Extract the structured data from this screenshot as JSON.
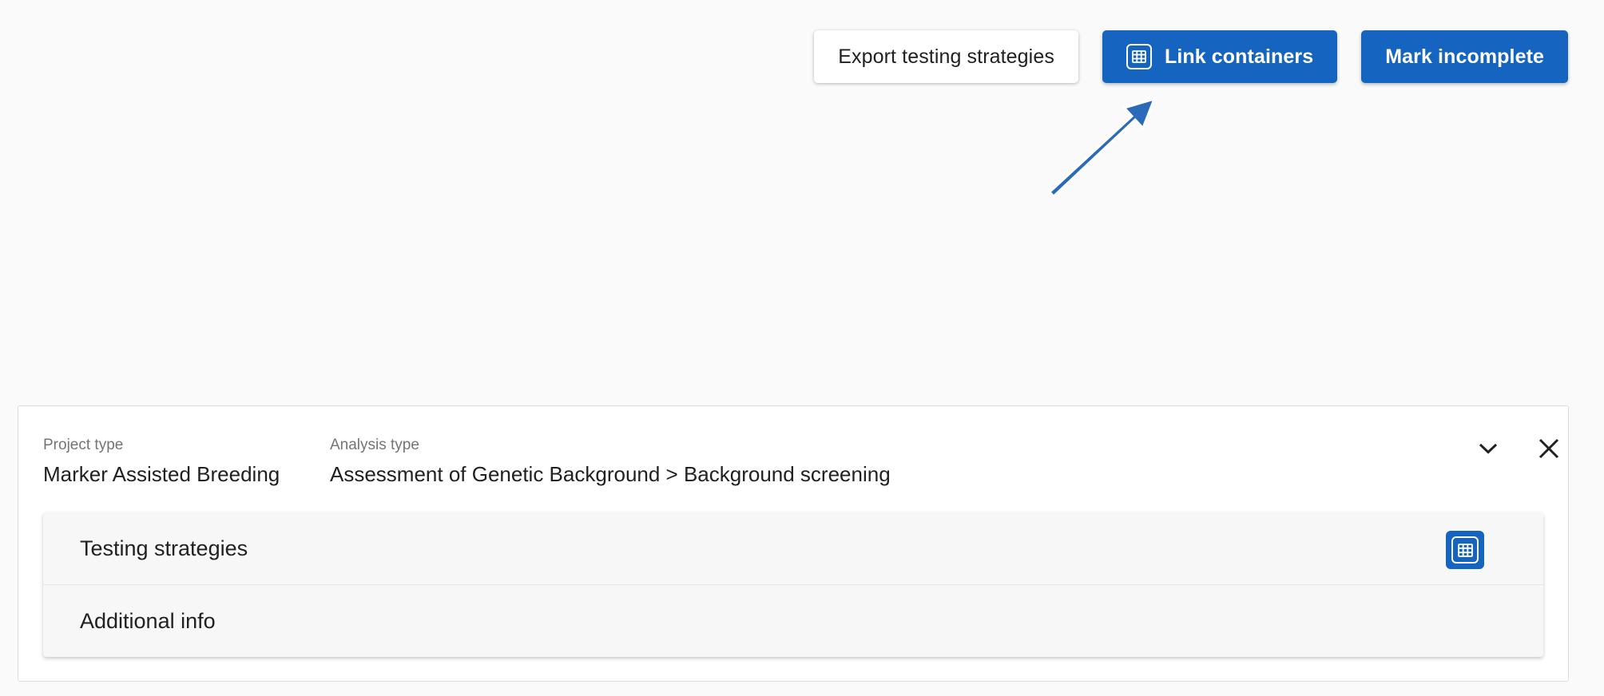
{
  "toolbar": {
    "export_label": "Export testing strategies",
    "link_label": "Link containers",
    "mark_label": "Mark incomplete"
  },
  "colors": {
    "primary": "#1565c0",
    "arrow": "#2a6ab8",
    "background": "#fafafa"
  },
  "icons": {
    "link": "table-icon",
    "collapse": "chevron-down-icon",
    "close": "close-icon",
    "pointer": "arrow-annotation"
  },
  "card": {
    "project_type_label": "Project type",
    "project_type_value": "Marker Assisted Breeding",
    "analysis_type_label": "Analysis type",
    "analysis_type_value": "Assessment of Genetic Background > Background screening",
    "panels": [
      {
        "label": "Testing strategies"
      },
      {
        "label": "Additional info"
      }
    ]
  }
}
